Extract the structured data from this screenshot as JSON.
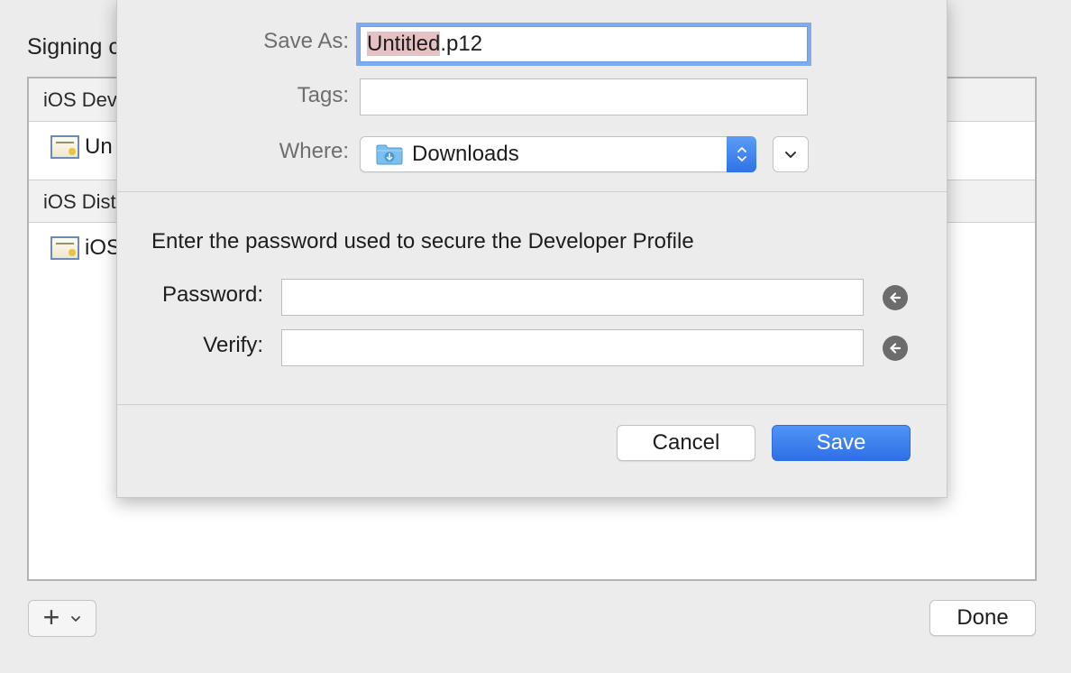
{
  "background": {
    "title": "Signing c",
    "groups": [
      {
        "header": "iOS Dev",
        "item": "Un"
      },
      {
        "header": "iOS Dist",
        "item": "iOS"
      }
    ],
    "add_label": "+",
    "done_label": "Done"
  },
  "save_sheet": {
    "save_as_label": "Save As:",
    "filename_selected": "Untitled",
    "filename_ext": ".p12",
    "tags_label": "Tags:",
    "tags_value": "",
    "where_label": "Where:",
    "where_value": "Downloads",
    "password_prompt": "Enter the password used to secure the Developer Profile",
    "password_label": "Password:",
    "password_value": "",
    "verify_label": "Verify:",
    "verify_value": "",
    "cancel_label": "Cancel",
    "save_label": "Save"
  },
  "colors": {
    "accent": "#2f73e6",
    "selection": "#e5c1c3",
    "focus_ring": "#7fabf1"
  },
  "icons": {
    "certificate": "certificate-icon",
    "folder": "downloads-folder-icon",
    "stepper": "up-down-chevron-icon",
    "expand": "chevron-down-icon",
    "key": "arrow-left-circle-icon"
  }
}
